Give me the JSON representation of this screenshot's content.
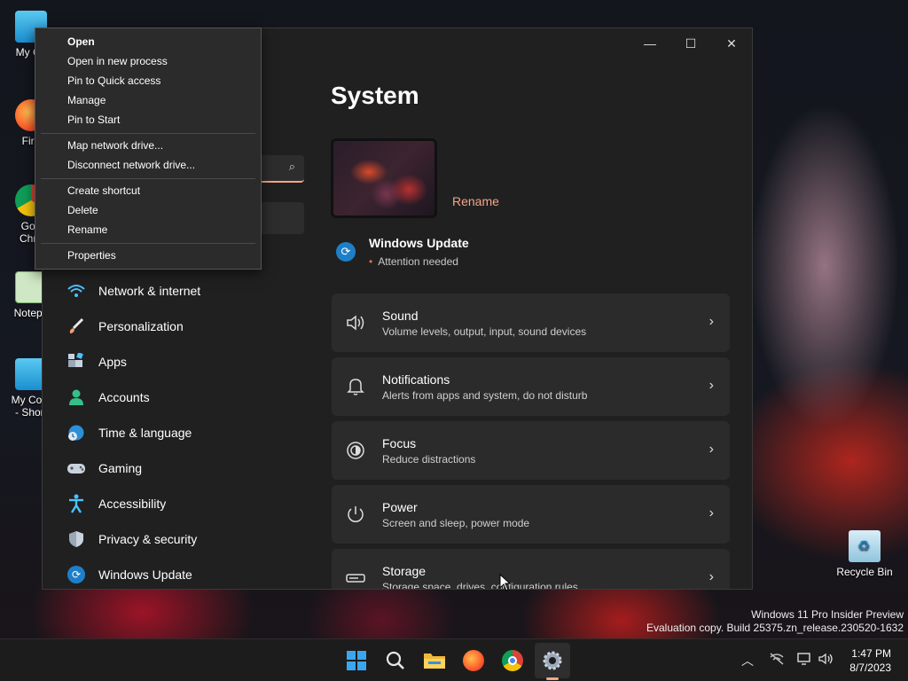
{
  "desktop": {
    "icons": [
      {
        "label": "My Co",
        "icon": "computer-icon"
      },
      {
        "label": "Fire",
        "icon": "firefox-icon"
      },
      {
        "label": "Goo\nChro",
        "icon": "chrome-icon"
      },
      {
        "label": "Notepa",
        "icon": "notepad-icon"
      },
      {
        "label": "My Com\n- Short",
        "icon": "computer-shortcut-icon"
      },
      {
        "label": "Recycle Bin",
        "icon": "recycle-bin-icon"
      }
    ],
    "watermark": {
      "line1": "Windows 11 Pro Insider Preview",
      "line2": "Evaluation copy. Build 25375.zn_release.230520-1632"
    }
  },
  "context_menu": {
    "items": [
      "Open",
      "Open in new process",
      "Pin to Quick access",
      "Manage",
      "Pin to Start",
      "Map network drive...",
      "Disconnect network drive...",
      "Create shortcut",
      "Delete",
      "Rename",
      "Properties"
    ]
  },
  "settings": {
    "window_controls": {
      "minimize": "—",
      "maximize": "☐",
      "close": "✕"
    },
    "search_icon": "search-icon",
    "nav": [
      {
        "label": "Network & internet",
        "icon": "wifi-icon"
      },
      {
        "label": "Personalization",
        "icon": "brush-icon"
      },
      {
        "label": "Apps",
        "icon": "apps-icon"
      },
      {
        "label": "Accounts",
        "icon": "person-icon"
      },
      {
        "label": "Time & language",
        "icon": "globe-clock-icon"
      },
      {
        "label": "Gaming",
        "icon": "gamepad-icon"
      },
      {
        "label": "Accessibility",
        "icon": "accessibility-icon"
      },
      {
        "label": "Privacy & security",
        "icon": "shield-icon"
      },
      {
        "label": "Windows Update",
        "icon": "update-icon"
      }
    ],
    "page_title": "System",
    "rename_label": "Rename",
    "windows_update": {
      "title": "Windows Update",
      "status": "Attention needed"
    },
    "cards": [
      {
        "title": "Sound",
        "subtitle": "Volume levels, output, input, sound devices",
        "icon": "speaker-icon"
      },
      {
        "title": "Notifications",
        "subtitle": "Alerts from apps and system, do not disturb",
        "icon": "bell-icon"
      },
      {
        "title": "Focus",
        "subtitle": "Reduce distractions",
        "icon": "focus-icon"
      },
      {
        "title": "Power",
        "subtitle": "Screen and sleep, power mode",
        "icon": "power-icon"
      },
      {
        "title": "Storage",
        "subtitle": "Storage space, drives, configuration rules",
        "icon": "storage-icon"
      }
    ]
  },
  "taskbar": {
    "apps": [
      "windows-start-icon",
      "search-icon",
      "file-explorer-icon",
      "firefox-icon",
      "chrome-icon",
      "settings-icon"
    ],
    "tray": [
      "chevron-up-icon",
      "network-off-icon",
      "display-icon",
      "volume-icon"
    ],
    "time": "1:47 PM",
    "date": "8/7/2023"
  },
  "colors": {
    "accent": "#f4a58a",
    "update_blue": "#1e7fc8",
    "window_bg": "#202020",
    "card_bg": "#2b2b2b"
  }
}
